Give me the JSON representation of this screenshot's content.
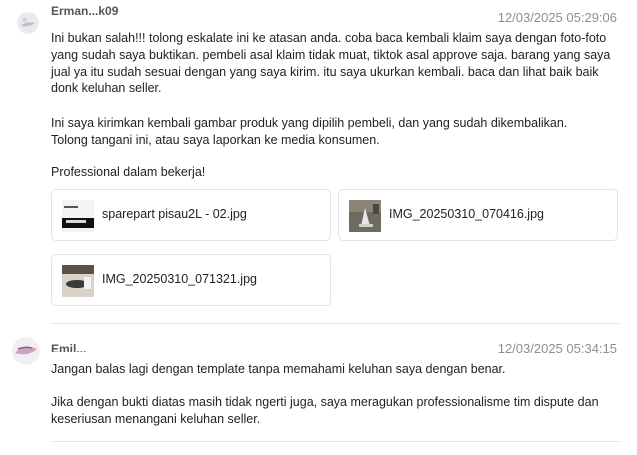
{
  "messages": [
    {
      "sender": "Erman...k09",
      "timestamp": "12/03/2025 05:29:06",
      "paragraphs": [
        "Ini bukan salah!!! tolong eskalate ini ke atasan anda. coba baca kembali klaim saya dengan foto-foto yang sudah saya buktikan. pembeli asal klaim tidak muat, tiktok asal approve saja. barang yang saya jual ya itu sudah sesuai dengan yang saya kirim. itu saya ukurkan kembali. baca dan lihat baik baik donk keluhan seller.",
        "Ini saya kirimkan kembali gambar produk yang dipilih pembeli, dan yang sudah dikembalikan.\nTolong tangani ini, atau saya laporkan ke media konsumen.",
        "Professional dalam bekerja!"
      ],
      "attachments": [
        {
          "filename": "sparepart pisau2L - 02.jpg"
        },
        {
          "filename": "IMG_20250310_070416.jpg"
        },
        {
          "filename": "IMG_20250310_071321.jpg"
        }
      ]
    },
    {
      "sender": "Emil...",
      "timestamp": "12/03/2025 05:34:15",
      "paragraphs": [
        "Jangan balas lagi dengan template tanpa memahami keluhan saya dengan benar.",
        "Jika dengan bukti diatas masih tidak ngerti juga, saya meragukan professionalisme tim dispute dan keseriusan menangani keluhan seller."
      ]
    }
  ],
  "colors": {
    "text": "#222222",
    "timestamp": "#8a8f98",
    "border": "#e1e4e8",
    "divider": "#e6e8eb"
  }
}
